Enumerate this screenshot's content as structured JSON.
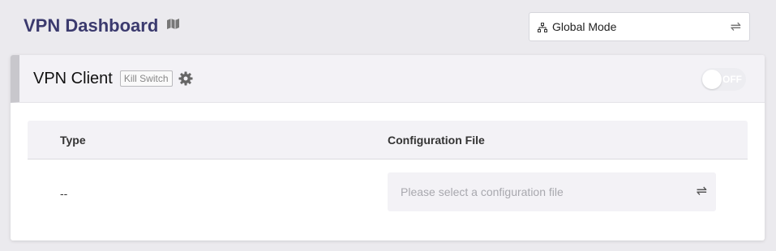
{
  "header": {
    "title": "VPN Dashboard",
    "title_icon": "vpn-map-icon",
    "mode_select": {
      "value": "Global Mode",
      "icon": "network-icon",
      "toggle_icon": "swap-icon"
    }
  },
  "card": {
    "title": "VPN Client",
    "kill_switch_label": "Kill Switch",
    "settings_icon": "gear-icon",
    "toggle": {
      "label": "OFF",
      "state": "off"
    },
    "table": {
      "columns": [
        "Type",
        "Configuration File"
      ],
      "rows": [
        {
          "type": "--",
          "config_placeholder": "Please select a configuration file"
        }
      ]
    }
  },
  "colors": {
    "background": "#ebeaee",
    "title": "#3b3a6e",
    "card_header": "#f3f2f6"
  }
}
